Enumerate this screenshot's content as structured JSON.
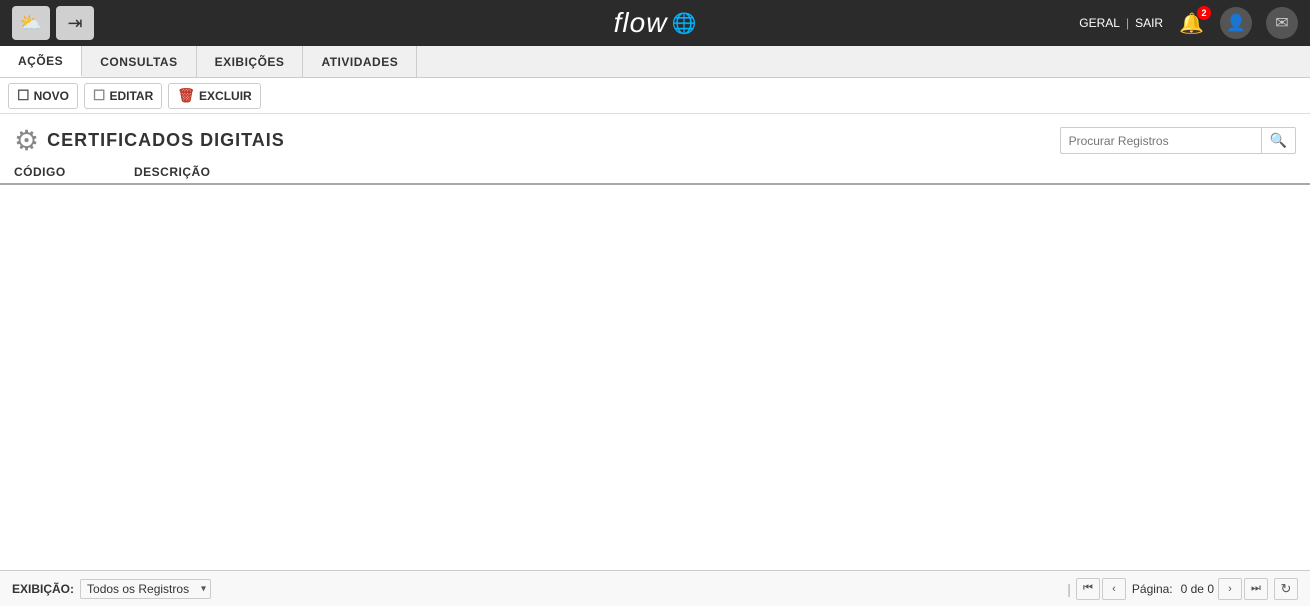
{
  "header": {
    "logo_text": "flow",
    "logo_icon": "☁",
    "nav_geral": "GERAL",
    "nav_sep": "|",
    "nav_sair": "SAIR",
    "notif_count": "2",
    "icon_cloud": "⛅",
    "icon_exit": "→"
  },
  "tabs": [
    {
      "id": "acoes",
      "label": "AÇÕES",
      "active": true
    },
    {
      "id": "consultas",
      "label": "CONSULTAS",
      "active": false
    },
    {
      "id": "exibicoes",
      "label": "EXIBIÇÕES",
      "active": false
    },
    {
      "id": "atividades",
      "label": "ATIVIDADES",
      "active": false
    }
  ],
  "toolbar": {
    "novo_label": "NOVO",
    "editar_label": "EDITAR",
    "excluir_label": "EXCLUIR"
  },
  "page": {
    "title": "CERTIFICADOS DIGITAIS",
    "search_placeholder": "Procurar Registros"
  },
  "table": {
    "col_codigo": "CÓDIGO",
    "col_descricao": "DESCRIÇÃO"
  },
  "footer": {
    "exibicao_label": "EXIBIÇÃO:",
    "exibicao_value": "Todos os Registros",
    "page_label": "Página:",
    "page_value": "0 de 0"
  }
}
